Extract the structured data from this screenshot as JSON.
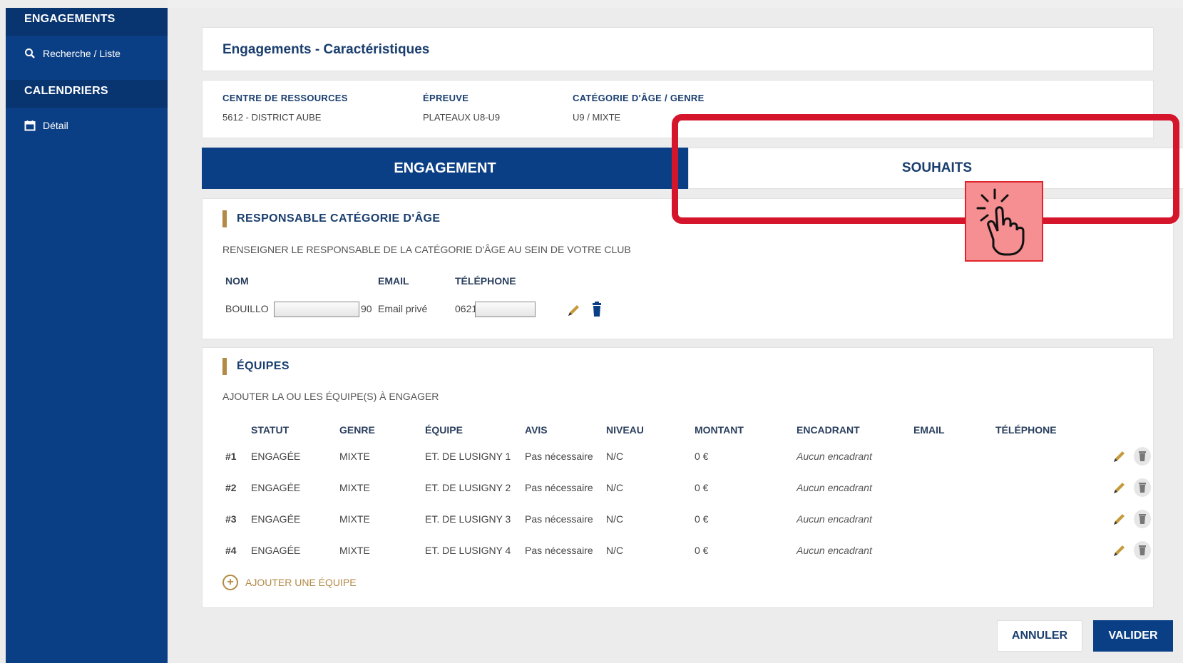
{
  "sidebar": {
    "sections": [
      {
        "title": "ENGAGEMENTS",
        "items": [
          {
            "label": "Recherche / Liste",
            "icon": "search-icon"
          }
        ]
      },
      {
        "title": "CALENDRIERS",
        "items": [
          {
            "label": "Détail",
            "icon": "calendar-icon"
          }
        ]
      }
    ]
  },
  "page": {
    "title": "Engagements - Caractéristiques"
  },
  "info": {
    "centre_label": "CENTRE DE RESSOURCES",
    "centre_value": "5612 - DISTRICT AUBE",
    "epreuve_label": "ÉPREUVE",
    "epreuve_value": "PLATEAUX U8-U9",
    "categorie_label": "CATÉGORIE D'ÂGE / GENRE",
    "categorie_value": "U9 / MIXTE"
  },
  "tabs": [
    {
      "label": "ENGAGEMENT",
      "active": true
    },
    {
      "label": "SOUHAITS",
      "active": false
    }
  ],
  "responsable": {
    "title": "RESPONSABLE CATÉGORIE D'ÂGE",
    "subtitle": "RENSEIGNER LE RESPONSABLE DE LA CATÉGORIE D'ÂGE AU SEIN DE VOTRE CLUB",
    "headers": {
      "nom": "NOM",
      "email": "EMAIL",
      "telephone": "TÉLÉPHONE"
    },
    "row": {
      "nom_prefix": "BOUILLO",
      "nom_suffix": "90",
      "email": "Email privé",
      "telephone_prefix": "0621"
    }
  },
  "equipes": {
    "title": "ÉQUIPES",
    "subtitle": "AJOUTER LA OU LES ÉQUIPE(S) À ENGAGER",
    "headers": {
      "statut": "STATUT",
      "genre": "GENRE",
      "equipe": "ÉQUIPE",
      "avis": "AVIS",
      "niveau": "NIVEAU",
      "montant": "MONTANT",
      "encadrant": "ENCADRANT",
      "email": "EMAIL",
      "telephone": "TÉLÉPHONE"
    },
    "rows": [
      {
        "num": "#1",
        "statut": "ENGAGÉE",
        "genre": "MIXTE",
        "equipe": "ET. DE LUSIGNY 1",
        "avis": "Pas nécessaire",
        "niveau": "N/C",
        "montant": "0 €",
        "encadrant": "Aucun encadrant"
      },
      {
        "num": "#2",
        "statut": "ENGAGÉE",
        "genre": "MIXTE",
        "equipe": "ET. DE LUSIGNY 2",
        "avis": "Pas nécessaire",
        "niveau": "N/C",
        "montant": "0 €",
        "encadrant": "Aucun encadrant"
      },
      {
        "num": "#3",
        "statut": "ENGAGÉE",
        "genre": "MIXTE",
        "equipe": "ET. DE LUSIGNY 3",
        "avis": "Pas nécessaire",
        "niveau": "N/C",
        "montant": "0 €",
        "encadrant": "Aucun encadrant"
      },
      {
        "num": "#4",
        "statut": "ENGAGÉE",
        "genre": "MIXTE",
        "equipe": "ET. DE LUSIGNY 4",
        "avis": "Pas nécessaire",
        "niveau": "N/C",
        "montant": "0 €",
        "encadrant": "Aucun encadrant"
      }
    ],
    "add_label": "AJOUTER UNE ÉQUIPE"
  },
  "actions": {
    "cancel": "ANNULER",
    "submit": "VALIDER"
  },
  "colors": {
    "primary": "#0b3f85",
    "accent": "#b38a45",
    "highlight": "#d4152b"
  }
}
